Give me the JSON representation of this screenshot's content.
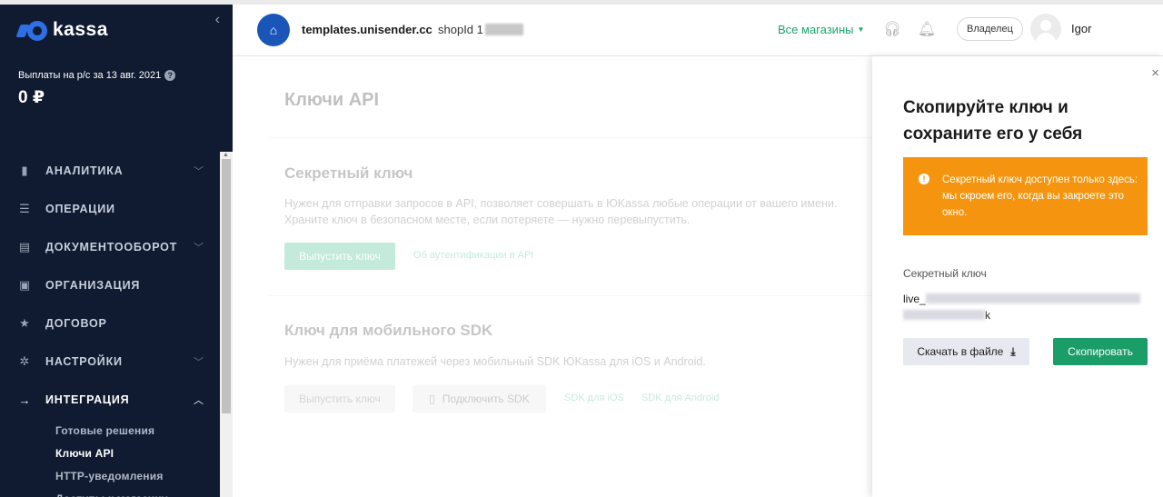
{
  "sidebar": {
    "logo_text": "kassa",
    "collapse_icon": "‹",
    "payout_label": "Выплаты на р/с за 13 авг. 2021",
    "payout_value": "0 ₽",
    "items": [
      {
        "label": "АНАЛИТИКА",
        "icon": "chart-icon",
        "glyph": "▮",
        "chevron": true
      },
      {
        "label": "ОПЕРАЦИИ",
        "icon": "list-icon",
        "glyph": "☰",
        "chevron": false
      },
      {
        "label": "ДОКУМЕНТООБОРОТ",
        "icon": "document-icon",
        "glyph": "▤",
        "chevron": true
      },
      {
        "label": "ОРГАНИЗАЦИЯ",
        "icon": "organization-icon",
        "glyph": "▣",
        "chevron": false
      },
      {
        "label": "ДОГОВОР",
        "icon": "star-icon",
        "glyph": "★",
        "chevron": false
      },
      {
        "label": "НАСТРОЙКИ",
        "icon": "gear-icon",
        "glyph": "✲",
        "chevron": true
      },
      {
        "label": "ИНТЕГРАЦИЯ",
        "icon": "arrow-right-icon",
        "glyph": "→",
        "chevron": true,
        "active": true
      }
    ],
    "sub_items": [
      {
        "label": "Готовые решения"
      },
      {
        "label": "Ключи API",
        "active": true
      },
      {
        "label": "HTTP-уведомления"
      },
      {
        "label": "Доступы к магазину"
      }
    ]
  },
  "header": {
    "shop_name": "templates.unisender.cc",
    "shop_id_label": "shopId",
    "shop_id_visible": "1",
    "all_shops": "Все магазины",
    "owner_label": "Владелец",
    "user_name": "Igor"
  },
  "main": {
    "title": "Ключи API",
    "secret": {
      "title": "Секретный ключ",
      "text1": "Нужен для отправки запросов в API, позволяет совершать в ЮKassa любые операции от вашего имени.",
      "text2": "Храните ключ в безопасном месте, если потеряете — нужно перевыпустить.",
      "issue_button": "Выпустить ключ",
      "auth_link": "Об аутентификации в API"
    },
    "sdk": {
      "title": "Ключ для мобильного SDK",
      "text": "Нужен для приёма платежей через мобильный SDK ЮKassa для iOS и Android.",
      "issue_button": "Выпустить ключ",
      "connect_button": "Подключить SDK",
      "ios_link": "SDK для iOS",
      "android_link": "SDK для Android"
    }
  },
  "panel": {
    "title": "Скопируйте ключ и сохраните его у себя",
    "alert": "Секретный ключ доступен только здесь: мы скроем его, когда вы закроете это окно.",
    "key_label": "Секретный ключ",
    "key_prefix": "live_",
    "key_suffix": "k",
    "download_button": "Скачать в файле",
    "copy_button": "Скопировать",
    "close_icon": "×"
  },
  "colors": {
    "sidebar_bg": "#101b31",
    "accent_green": "#1a9d68",
    "alert_orange": "#f5950f",
    "brand_blue": "#2f6fe4"
  }
}
